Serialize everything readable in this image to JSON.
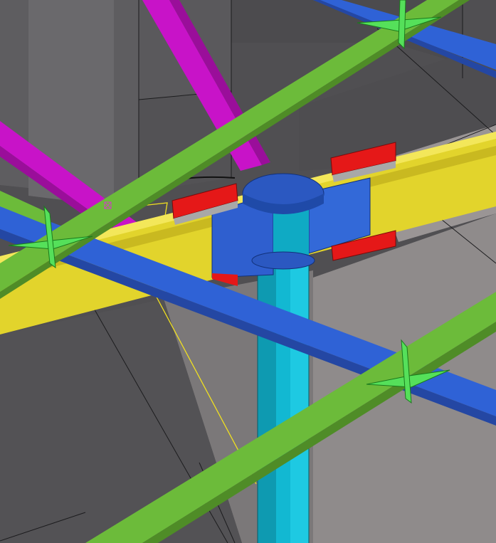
{
  "viewport": {
    "kind": "3d-structural-model-view"
  },
  "members": {
    "yellow_beam": {
      "color": "#e2d42c",
      "role": "main-beam"
    },
    "blue_bracing": {
      "color": "#2f62d6",
      "role": "horizontal-bracing"
    },
    "green_bracing": {
      "color": "#6cbb3a",
      "role": "diagonal-bracing"
    },
    "magenta_bracing": {
      "color": "#c813c8",
      "role": "diagonal-bracing"
    },
    "cyan_column": {
      "color": "#12b8d2",
      "role": "column"
    },
    "connection_plates": {
      "color": "#2f5fcf",
      "role": "connection"
    },
    "stiffeners": {
      "color": "#e51818",
      "role": "stiffener-plates"
    },
    "gusset_crosses": {
      "color": "#55e05a",
      "role": "brace-joints",
      "count": 3
    }
  },
  "scene_colors": {
    "background_dark": "#4c4b4e",
    "background_mid": "#5d5c5f",
    "background_light": "#8c8888",
    "edge_line": "#1a1a1a",
    "selection_line": "#f0e020",
    "pick_marker": "#d040c0"
  }
}
